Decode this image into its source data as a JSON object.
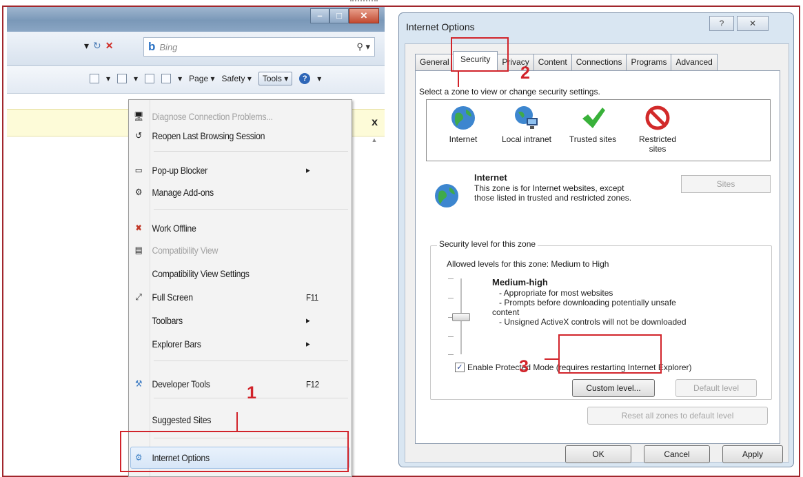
{
  "browser": {
    "search": {
      "placeholder": "Bing",
      "logo_label": "b"
    },
    "commandbar": {
      "page_label": "Page",
      "safety_label": "Safety",
      "tools_label": "Tools"
    },
    "infobar_close": "x"
  },
  "tools_menu": {
    "items": [
      {
        "label": "Diagnose Connection Problems...",
        "shortcut": "",
        "submenu": false,
        "disabled": true,
        "icon": "diagnose-icon"
      },
      {
        "label": "Reopen Last Browsing Session",
        "shortcut": "",
        "submenu": false,
        "disabled": false,
        "icon": "reopen-icon"
      },
      {
        "label": "Pop-up Blocker",
        "shortcut": "",
        "submenu": true,
        "disabled": false,
        "icon": "popup-blocker-icon"
      },
      {
        "label": "Manage Add-ons",
        "shortcut": "",
        "submenu": false,
        "disabled": false,
        "icon": "addons-icon"
      },
      {
        "label": "Work Offline",
        "shortcut": "",
        "submenu": false,
        "disabled": false,
        "icon": "work-offline-icon"
      },
      {
        "label": "Compatibility View",
        "shortcut": "",
        "submenu": false,
        "disabled": true,
        "icon": "compatibility-icon"
      },
      {
        "label": "Compatibility View Settings",
        "shortcut": "",
        "submenu": false,
        "disabled": false,
        "icon": ""
      },
      {
        "label": "Full Screen",
        "shortcut": "F11",
        "submenu": false,
        "disabled": false,
        "icon": "full-screen-icon"
      },
      {
        "label": "Toolbars",
        "shortcut": "",
        "submenu": true,
        "disabled": false,
        "icon": ""
      },
      {
        "label": "Explorer Bars",
        "shortcut": "",
        "submenu": true,
        "disabled": false,
        "icon": ""
      },
      {
        "label": "Developer Tools",
        "shortcut": "F12",
        "submenu": false,
        "disabled": false,
        "icon": "developer-tools-icon"
      },
      {
        "label": "Suggested Sites",
        "shortcut": "",
        "submenu": false,
        "disabled": false,
        "icon": ""
      },
      {
        "label": "Internet Options",
        "shortcut": "",
        "submenu": false,
        "disabled": false,
        "icon": "internet-options-icon"
      }
    ]
  },
  "dialog": {
    "title": "Internet Options",
    "help_label": "?",
    "close_label": "✕",
    "tabs": [
      "General",
      "Security",
      "Privacy",
      "Content",
      "Connections",
      "Programs",
      "Advanced"
    ],
    "active_tab": "Security",
    "zone_prompt": "Select a zone to view or change security settings.",
    "zones": [
      {
        "label": "Internet",
        "icon": "globe-icon"
      },
      {
        "label": "Local intranet",
        "icon": "local-intranet-icon"
      },
      {
        "label": "Trusted sites",
        "icon": "checkmark-icon"
      },
      {
        "label": "Restricted sites",
        "icon": "restricted-icon"
      }
    ],
    "selected_zone": {
      "title": "Internet",
      "description": "This zone is for Internet websites, except those listed in trusted and restricted zones."
    },
    "sites_button": "Sites",
    "security_group": {
      "legend": "Security level for this zone",
      "allowed": "Allowed levels for this zone: Medium to High",
      "level_title": "Medium-high",
      "level_lines": [
        "- Appropriate for most websites",
        "- Prompts before downloading potentially unsafe",
        "content",
        "- Unsigned ActiveX controls will not be downloaded"
      ],
      "protected_mode_label": "Enable Protected Mode (requires restarting Internet Explorer)",
      "protected_mode_checked": true,
      "custom_level_button": "Custom level...",
      "default_level_button": "Default level"
    },
    "reset_all_button": "Reset all zones to default level",
    "ok_button": "OK",
    "cancel_button": "Cancel",
    "apply_button": "Apply"
  },
  "annotations": {
    "step1": "1",
    "step2": "2",
    "step3": "3",
    "color": "#d1232a"
  }
}
